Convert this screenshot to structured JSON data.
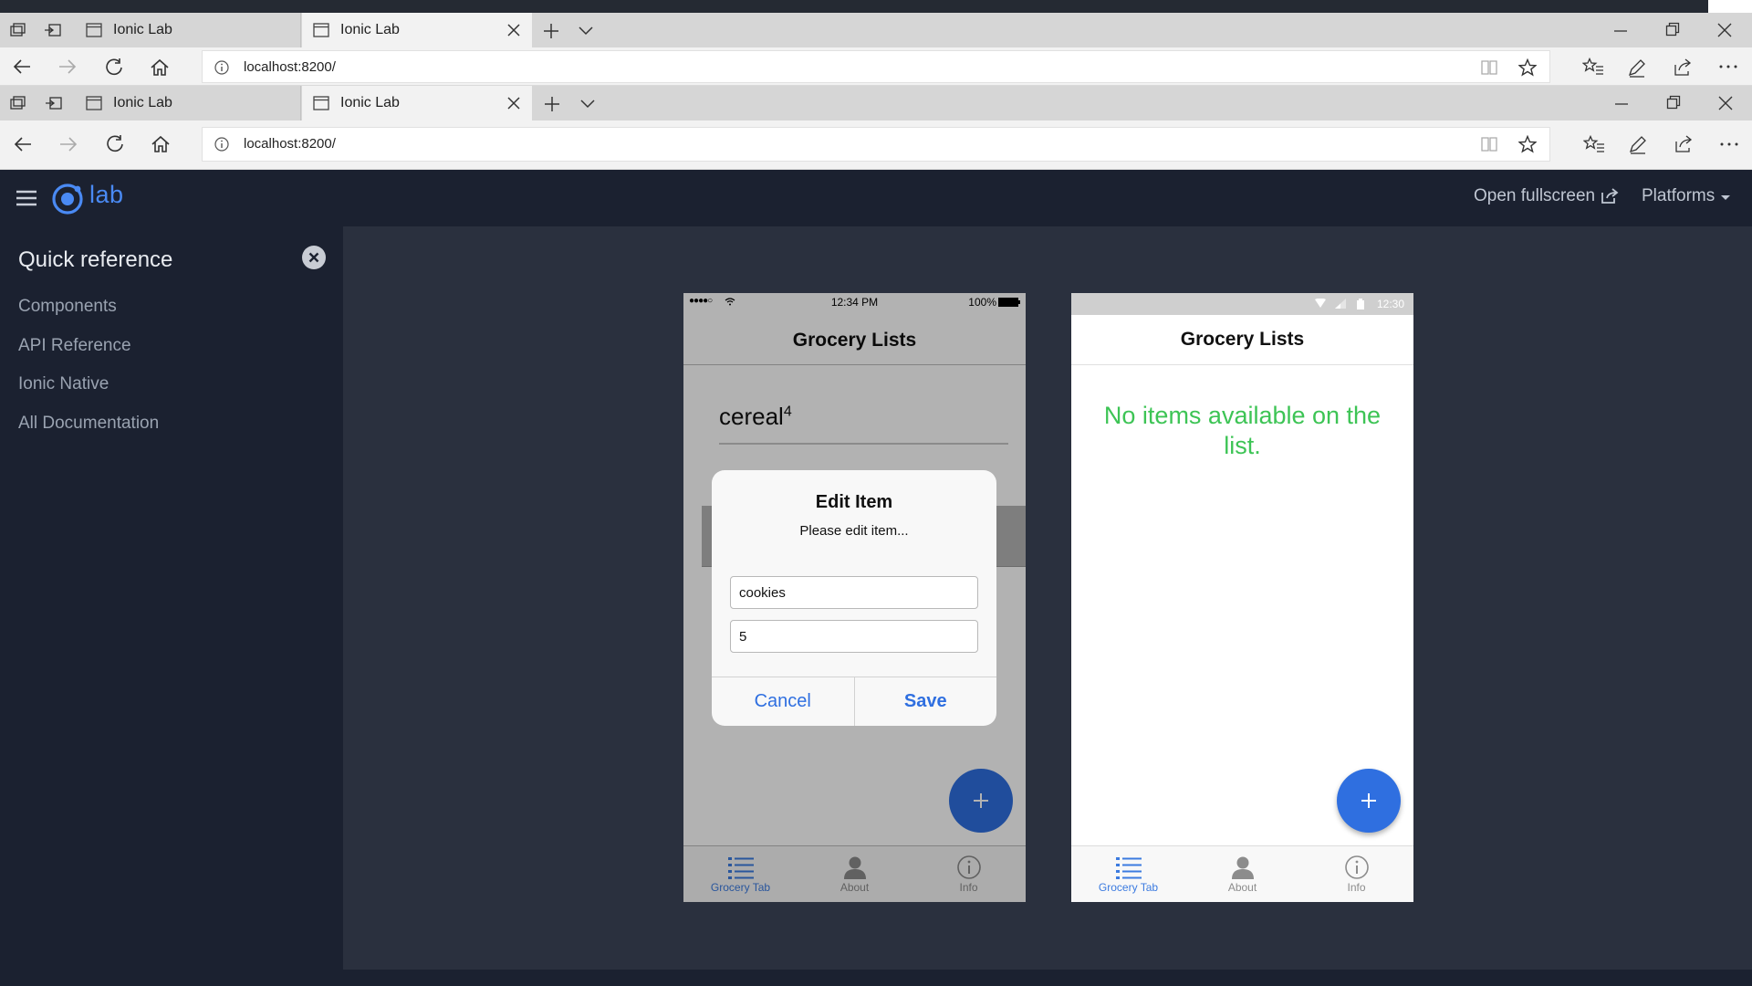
{
  "browser_outer": {
    "tabs": [
      {
        "label": "Ionic Lab",
        "active": false
      },
      {
        "label": "Ionic Lab",
        "active": true
      }
    ],
    "url": "localhost:8200/"
  },
  "browser_inner": {
    "tabs": [
      {
        "label": "Ionic Lab",
        "active": false
      },
      {
        "label": "Ionic Lab",
        "active": true
      }
    ],
    "url": "localhost:8200/"
  },
  "lab_header": {
    "logo_text": "lab",
    "open_fullscreen": "Open fullscreen",
    "platforms": "Platforms"
  },
  "sidebar": {
    "title": "Quick reference",
    "items": [
      "Components",
      "API Reference",
      "Ionic Native",
      "All Documentation"
    ]
  },
  "ios_phone": {
    "status": {
      "signal": "●●●●○",
      "time": "12:34 PM",
      "battery": "100%"
    },
    "title": "Grocery Lists",
    "list_item": {
      "name": "cereal",
      "qty": "4"
    },
    "dialog": {
      "title": "Edit Item",
      "message": "Please edit item...",
      "name_value": "cookies",
      "qty_value": "5",
      "cancel": "Cancel",
      "save": "Save"
    },
    "tabs": [
      "Grocery Tab",
      "About",
      "Info"
    ]
  },
  "android_phone": {
    "status": {
      "time": "12:30"
    },
    "title": "Grocery Lists",
    "empty_message": "No items available on the list.",
    "tabs": [
      "Grocery Tab",
      "About",
      "Info"
    ]
  },
  "colors": {
    "accent": "#4a8af4",
    "fab": "#2f6fe0",
    "empty_message": "#3dc455",
    "sidebar_bg": "#1b2130",
    "main_bg": "#2a303e"
  }
}
